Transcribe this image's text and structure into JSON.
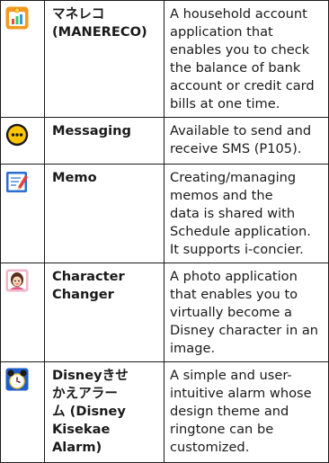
{
  "rows": [
    {
      "icon": "manereco-app-icon",
      "name_lines": [
        "マネレコ",
        "(MANERECO)"
      ],
      "desc_lines": [
        "A household account",
        "application that",
        "enables you to check",
        "the balance of bank",
        "account or credit card",
        "bills at one time."
      ]
    },
    {
      "icon": "messaging-app-icon",
      "name_lines": [
        "Messaging"
      ],
      "desc_lines": [
        "Available to send and",
        "receive SMS (P105)."
      ]
    },
    {
      "icon": "memo-app-icon",
      "name_lines": [
        "Memo"
      ],
      "desc_lines": [
        "Creating/managing",
        "memos and the",
        "data is shared with",
        "Schedule application.",
        "It supports i-concier."
      ]
    },
    {
      "icon": "character-changer-app-icon",
      "name_lines": [
        "Character",
        "Changer"
      ],
      "desc_lines": [
        "A photo application",
        "that enables you to",
        "virtually become a",
        "Disney character in an",
        "image."
      ]
    },
    {
      "icon": "disney-kisekae-alarm-app-icon",
      "name_lines": [
        "Disneyきせ",
        "かえアラー",
        "ム (Disney",
        "Kisekae",
        "Alarm)"
      ],
      "desc_lines": [
        "A simple and user-",
        "intuitive alarm whose",
        "design theme and",
        "ringtone can be",
        "customized."
      ]
    }
  ],
  "colors": {
    "border": "#1a1a1a",
    "text": "#1a1a1a",
    "manereco_orange": "#f39a1e",
    "messaging_yellow": "#ffc400",
    "memo_blue": "#2a6fd0",
    "memo_pencil_red": "#e0443a",
    "character_pink": "#f5b6c8",
    "alarm_blue": "#1f5ec9"
  }
}
